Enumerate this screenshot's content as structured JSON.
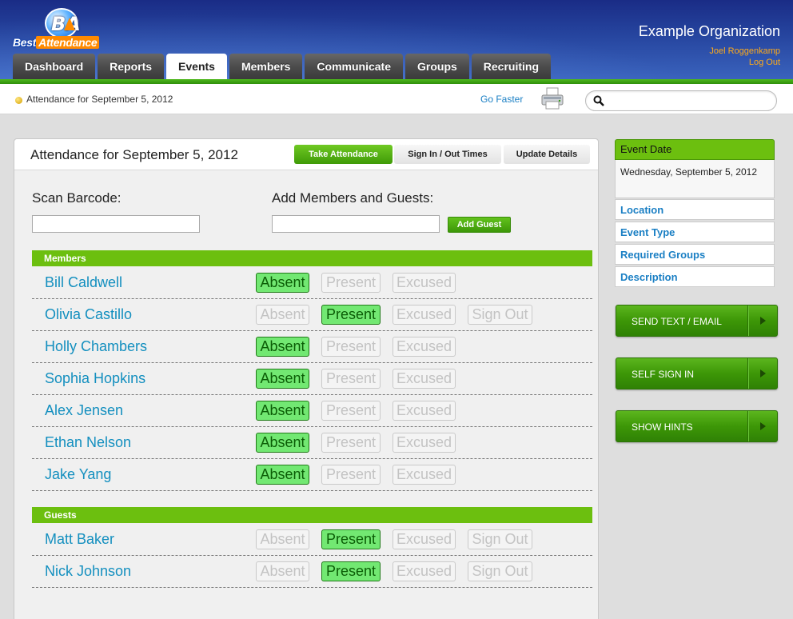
{
  "brand": {
    "logo_letters": "BA",
    "logo_word1": "Best",
    "logo_word2": "Attendance"
  },
  "header": {
    "org_name": "Example Organization",
    "user_name": "Joel Roggenkamp",
    "logout_label": "Log Out",
    "nav": [
      "Dashboard",
      "Reports",
      "Events",
      "Members",
      "Communicate",
      "Groups",
      "Recruiting"
    ],
    "active_nav": "Events"
  },
  "subbar": {
    "breadcrumb": "Attendance for September 5, 2012",
    "go_faster": "Go Faster",
    "search_placeholder": ""
  },
  "panel": {
    "title": "Attendance for September 5, 2012",
    "tabs": [
      "Take Attendance",
      "Sign In / Out Times",
      "Update Details"
    ],
    "active_tab": "Take Attendance",
    "scan_label": "Scan Barcode:",
    "add_label": "Add Members and Guests:",
    "add_guest_button": "Add Guest",
    "members_heading": "Members",
    "guests_heading": "Guests",
    "button_labels": {
      "absent": "Absent",
      "present": "Present",
      "excused": "Excused",
      "signout": "Sign Out"
    },
    "members": [
      {
        "name": "Bill Caldwell",
        "status": "Absent",
        "sign_out": false
      },
      {
        "name": "Olivia Castillo",
        "status": "Present",
        "sign_out": true
      },
      {
        "name": "Holly Chambers",
        "status": "Absent",
        "sign_out": false
      },
      {
        "name": "Sophia Hopkins",
        "status": "Absent",
        "sign_out": false
      },
      {
        "name": "Alex Jensen",
        "status": "Absent",
        "sign_out": false
      },
      {
        "name": "Ethan Nelson",
        "status": "Absent",
        "sign_out": false
      },
      {
        "name": "Jake Yang",
        "status": "Absent",
        "sign_out": false
      }
    ],
    "guests": [
      {
        "name": "Matt Baker",
        "status": "Present",
        "sign_out": true
      },
      {
        "name": "Nick Johnson",
        "status": "Present",
        "sign_out": true
      }
    ]
  },
  "sidebar": {
    "event_date_label": "Event Date",
    "event_date_value": "Wednesday, September 5, 2012",
    "links": [
      "Location",
      "Event Type",
      "Required Groups",
      "Description"
    ],
    "actions": [
      "SEND TEXT / EMAIL",
      "SELF SIGN IN",
      "SHOW HINTS"
    ]
  },
  "colors": {
    "header_blue": "#26459f",
    "accent_green": "#6cbf0f",
    "link_blue": "#138fbf",
    "active_status": "#72e872"
  }
}
